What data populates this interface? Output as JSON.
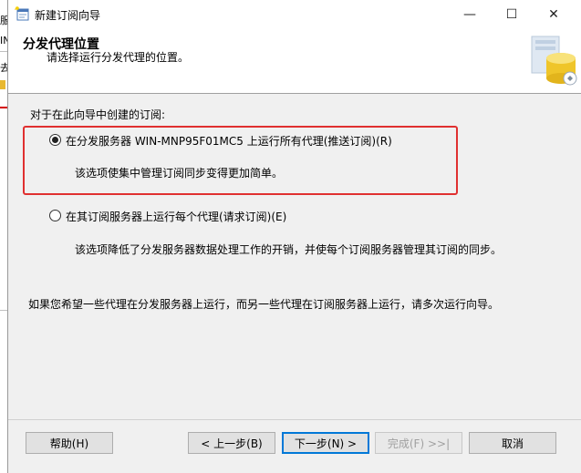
{
  "background_window": {
    "fragments": [
      "服",
      "IN",
      "去"
    ]
  },
  "window": {
    "title": "新建订阅向导",
    "controls": {
      "minimize": "—",
      "maximize": "☐",
      "close": "✕"
    }
  },
  "header": {
    "title": "分发代理位置",
    "subtitle": "请选择运行分发代理的位置。"
  },
  "content": {
    "group_label": "对于在此向导中创建的订阅:",
    "options": [
      {
        "label": "在分发服务器 WIN-MNP95F01MC5 上运行所有代理(推送订阅)(R)",
        "description": "该选项使集中管理订阅同步变得更加简单。",
        "selected": true
      },
      {
        "label": "在其订阅服务器上运行每个代理(请求订阅)(E)",
        "description": "该选项降低了分发服务器数据处理工作的开销，并使每个订阅服务器管理其订阅的同步。",
        "selected": false
      }
    ],
    "note": "如果您希望一些代理在分发服务器上运行，而另一些代理在订阅服务器上运行，请多次运行向导。"
  },
  "buttons": {
    "help": "帮助(H)",
    "back": "< 上一步(B)",
    "next": "下一步(N) >",
    "finish": "完成(F) >>|",
    "cancel": "取消"
  },
  "colors": {
    "highlight_border": "#e03030",
    "primary_button_border": "#0078d7"
  }
}
